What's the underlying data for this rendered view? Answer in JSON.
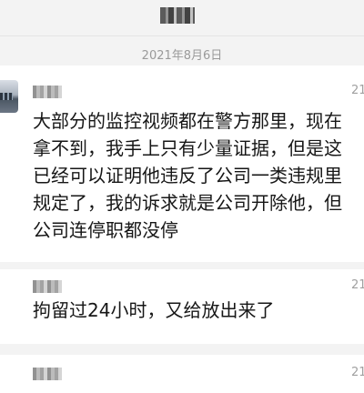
{
  "header": {
    "date": "2021年8月6日"
  },
  "messages": [
    {
      "time_fragment": "21",
      "lines": [
        "大部分的监控视频都在警方那里，现在",
        "拿不到，我手上只有少量证据，但是这",
        "已经可以证明他违反了公司一类违规里",
        "规定了，我的诉求就是公司开除他，但",
        "公司连停职都没停"
      ]
    },
    {
      "time_fragment": "21",
      "lines": [
        "拘留过24小时，又给放出来了"
      ]
    },
    {
      "time_fragment": "21",
      "lines": []
    }
  ]
}
